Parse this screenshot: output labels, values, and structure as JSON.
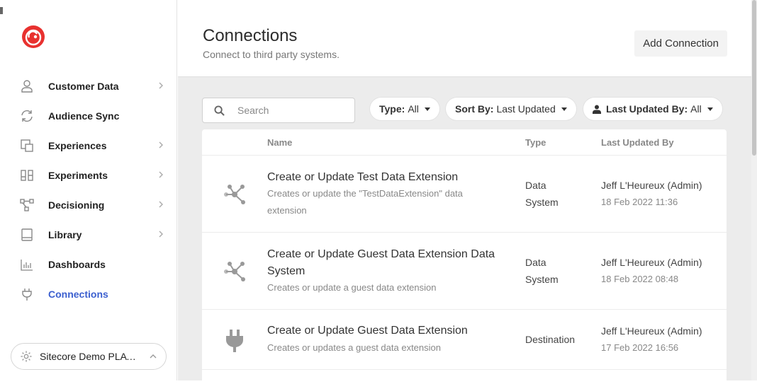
{
  "sidebar": {
    "items": [
      {
        "label": "Customer Data",
        "icon": "person-icon",
        "chevron": true
      },
      {
        "label": "Audience Sync",
        "icon": "sync-icon",
        "chevron": false
      },
      {
        "label": "Experiences",
        "icon": "experiences-icon",
        "chevron": true
      },
      {
        "label": "Experiments",
        "icon": "experiments-icon",
        "chevron": true
      },
      {
        "label": "Decisioning",
        "icon": "decisioning-icon",
        "chevron": true
      },
      {
        "label": "Library",
        "icon": "library-icon",
        "chevron": true
      },
      {
        "label": "Dashboards",
        "icon": "dashboards-icon",
        "chevron": false
      },
      {
        "label": "Connections",
        "icon": "plug-icon",
        "chevron": false,
        "active": true
      }
    ],
    "workspace": {
      "label": "Sitecore Demo PLAY! ..."
    }
  },
  "header": {
    "title": "Connections",
    "subtitle": "Connect to third party systems.",
    "add_label": "Add Connection"
  },
  "toolbar": {
    "search_placeholder": "Search",
    "filters": {
      "type": {
        "key": "Type:",
        "value": "All"
      },
      "sort": {
        "key": "Sort By:",
        "value": "Last Updated"
      },
      "updated_by": {
        "key": "Last Updated By:",
        "value": "All"
      }
    }
  },
  "table": {
    "columns": {
      "name": "Name",
      "type": "Type",
      "updated_by": "Last Updated By"
    },
    "rows": [
      {
        "icon": "data-system-icon",
        "name": "Create or Update Test Data Extension",
        "desc": "Creates or update the \"TestDataExtension\" data extension",
        "type": "Data System",
        "user": "Jeff L'Heureux (Admin)",
        "date": "18 Feb 2022 11:36"
      },
      {
        "icon": "data-system-icon",
        "name": "Create or Update Guest Data Extension Data System",
        "desc": "Creates or update a guest data extension",
        "type": "Data System",
        "user": "Jeff L'Heureux (Admin)",
        "date": "18 Feb 2022 08:48"
      },
      {
        "icon": "plug-icon",
        "name": "Create or Update Guest Data Extension",
        "desc": "Creates or updates a guest data extension",
        "type": "Destination",
        "user": "Jeff L'Heureux (Admin)",
        "date": "17 Feb 2022 16:56"
      }
    ]
  },
  "colors": {
    "accent": "#3b5fcf",
    "logo": "#e8312f",
    "content_bg": "#ececec"
  }
}
